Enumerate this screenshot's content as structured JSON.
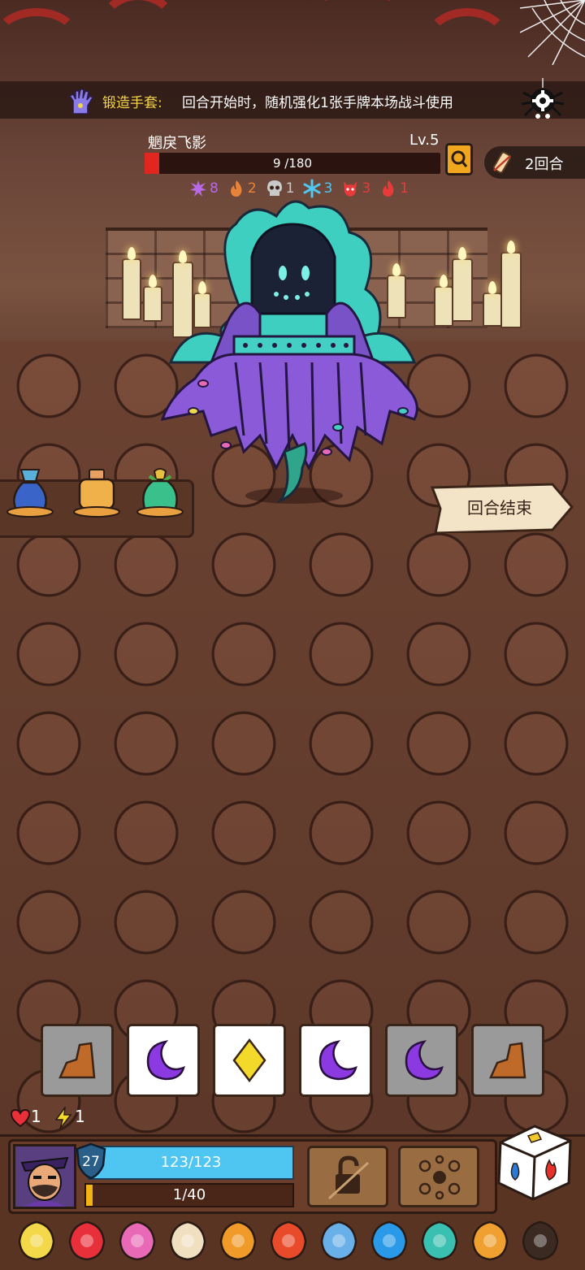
{
  "banner": {
    "relic_name": "锻造手套:",
    "relic_desc": "回合开始时，随机强化1张手牌本场战斗使用"
  },
  "enemy": {
    "name": "魍戾飞影",
    "level": "Lv.5",
    "hp_text": "9 /180",
    "hp_fraction": 0.05,
    "statuses": [
      {
        "icon": "splat-icon",
        "value": "8",
        "color": "#b86ae6"
      },
      {
        "icon": "flame-icon",
        "value": "2",
        "color": "#e8843a"
      },
      {
        "icon": "skull-icon",
        "value": "1",
        "color": "#c9c9c9"
      },
      {
        "icon": "snowflake-icon",
        "value": "3",
        "color": "#4fc9f0"
      },
      {
        "icon": "demon-icon",
        "value": "3",
        "color": "#e83a3a"
      },
      {
        "icon": "fire-icon",
        "value": "1",
        "color": "#e83a3a"
      }
    ]
  },
  "turn": {
    "label": "2回合"
  },
  "potions": [
    {
      "icon": "blue-potion-icon"
    },
    {
      "icon": "orange-potion-icon"
    },
    {
      "icon": "green-potion-icon"
    }
  ],
  "end_turn": {
    "label": "回合结束"
  },
  "dice": [
    {
      "face": "rock-icon",
      "bg": "grey"
    },
    {
      "face": "moon-icon",
      "bg": "white"
    },
    {
      "face": "diamond-icon",
      "bg": "white"
    },
    {
      "face": "moon-icon",
      "bg": "white"
    },
    {
      "face": "moon-icon",
      "bg": "grey"
    },
    {
      "face": "rock-icon",
      "bg": "grey"
    }
  ],
  "stats": {
    "hearts": "1",
    "energy": "1"
  },
  "player": {
    "shield": "27",
    "hp_text": "123/123",
    "xp_text": "1/40",
    "xp_fraction": 0.025
  },
  "relics": [
    "lantern-icon",
    "heart-jar-icon",
    "spiked-heart-icon",
    "shuriken-icon",
    "fire-jar-icon",
    "red-fish-icon",
    "goblet-icon",
    "water-drop-icon",
    "teal-vase-icon",
    "orange-drum-icon",
    "bat-icon"
  ]
}
